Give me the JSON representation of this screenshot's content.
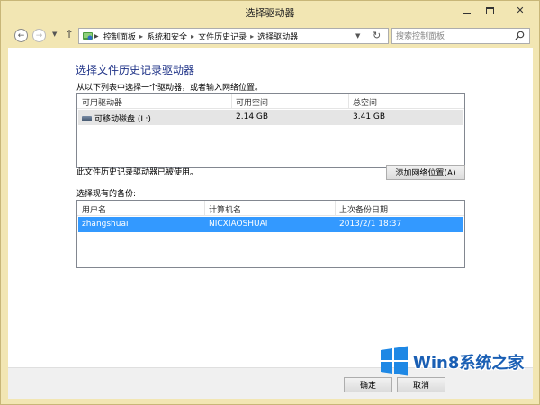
{
  "window": {
    "title": "选择驱动器",
    "frame_color": "#f2e6b3"
  },
  "nav": {
    "back_icon": "back-arrow-icon",
    "forward_icon": "forward-arrow-icon",
    "up_icon": "up-arrow-icon",
    "breadcrumbs": [
      "控制面板",
      "系统和安全",
      "文件历史记录",
      "选择驱动器"
    ],
    "search_placeholder": "搜索控制面板"
  },
  "main": {
    "heading": "选择文件历史记录驱动器",
    "instruction": "从以下列表中选择一个驱动器，或者输入网络位置。",
    "drive_list": {
      "columns": [
        "可用驱动器",
        "可用空间",
        "总空间"
      ],
      "rows": [
        {
          "name": "可移动磁盘 (L:)",
          "free": "2.14 GB",
          "total": "3.41 GB"
        }
      ]
    },
    "status": "此文件历史记录驱动器已被使用。",
    "add_network_label": "添加网络位置(A)",
    "select_backup_label": "选择现有的备份:",
    "backup_list": {
      "columns": [
        "用户名",
        "计算机名",
        "上次备份日期"
      ],
      "rows": [
        {
          "user": "zhangshuai",
          "computer": "NICXIAOSHUAI",
          "date": "2013/2/1 18:37"
        }
      ]
    }
  },
  "footer": {
    "ok_label": "确定",
    "cancel_label": "取消"
  },
  "watermark": {
    "text": "Win8系统之家"
  },
  "colors": {
    "heading": "#1e3287",
    "selection": "#3399ff"
  }
}
